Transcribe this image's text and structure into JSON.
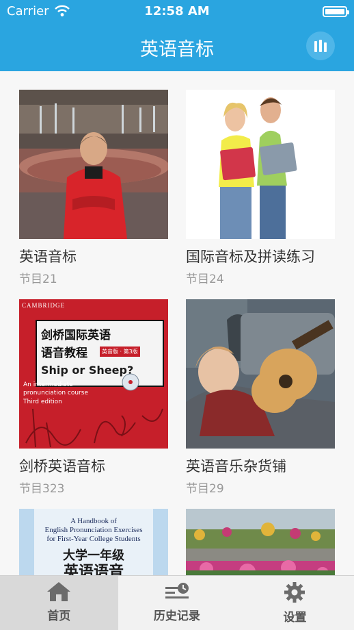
{
  "status": {
    "carrier": "Carrier",
    "time": "12:58 AM"
  },
  "nav": {
    "title": "英语音标"
  },
  "cards": [
    {
      "title": "英语音标",
      "subtitle": "节目21"
    },
    {
      "title": "国际音标及拼读练习",
      "subtitle": "节目24"
    },
    {
      "title": "剑桥英语音标",
      "subtitle": "节目323",
      "cover": {
        "publisher": "CAMBRIDGE",
        "heading1": "剑桥国际英语",
        "heading2": "语音教程",
        "edition_badge": "英音版 · 第3版",
        "subtitle_en": "Ship or Sheep?",
        "desc1": "An intermediate",
        "desc2": "pronunciation course",
        "desc3": "Third edition"
      }
    },
    {
      "title": "英语音乐杂货铺",
      "subtitle": "节目29"
    },
    {
      "title": "",
      "subtitle": "",
      "cover": {
        "line1": "A Handbook of",
        "line2": "English Pronunciation Exercises",
        "line3": "for First-Year College Students",
        "heading1": "大学一年级",
        "heading2": "英语语音"
      }
    },
    {
      "title": "",
      "subtitle": ""
    }
  ],
  "tabs": [
    {
      "label": "首页",
      "icon": "home-icon",
      "active": true
    },
    {
      "label": "历史记录",
      "icon": "history-icon",
      "active": false
    },
    {
      "label": "设置",
      "icon": "gear-icon",
      "active": false
    }
  ],
  "colors": {
    "accent": "#2aa5e0",
    "tab_active_bg": "#d9d9d9"
  }
}
